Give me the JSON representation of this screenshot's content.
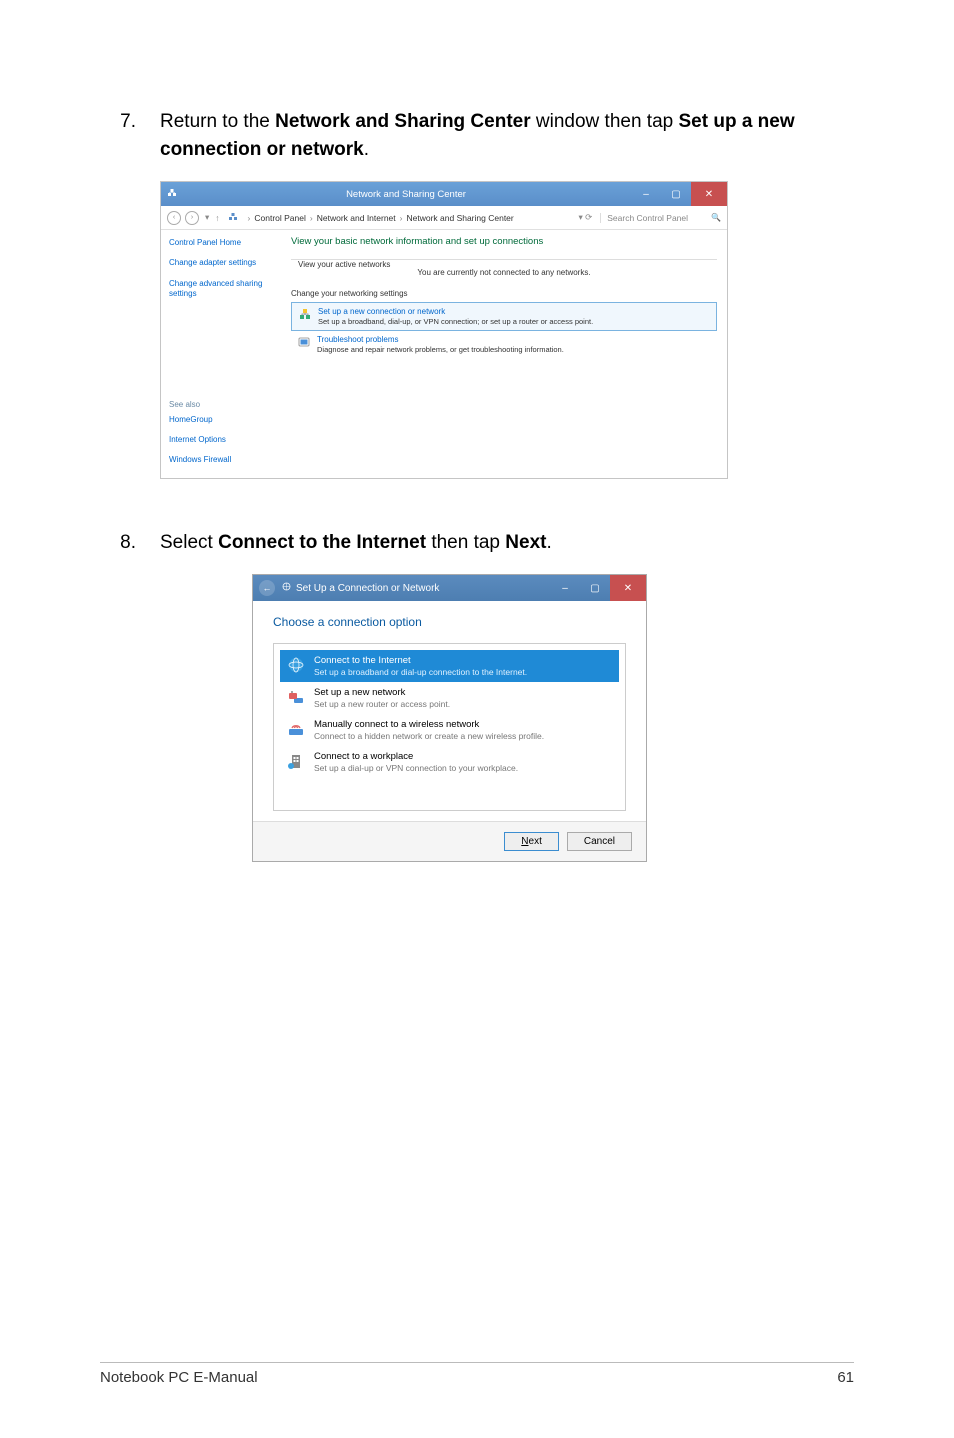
{
  "steps": {
    "s7": {
      "num": "7.",
      "text_before": "Return to the ",
      "bold1": "Network and Sharing Center",
      "text_mid": " window then tap ",
      "bold2": "Set up a new connection or network",
      "text_after": "."
    },
    "s8": {
      "num": "8.",
      "text_before": "Select ",
      "bold1": "Connect to the Internet",
      "text_mid": " then tap ",
      "bold2": "Next",
      "text_after": "."
    }
  },
  "scr1": {
    "title": "Network and Sharing Center",
    "breadcrumb": {
      "root": "Control Panel",
      "mid": "Network and Internet",
      "leaf": "Network and Sharing Center"
    },
    "search_placeholder": "Search Control Panel",
    "sidebar": {
      "home": "Control Panel Home",
      "adapter": "Change adapter settings",
      "advanced": "Change advanced sharing settings",
      "seealso_label": "See also",
      "seealso": {
        "homegroup": "HomeGroup",
        "internet_options": "Internet Options",
        "firewall": "Windows Firewall"
      }
    },
    "main": {
      "header": "View your basic network information and set up connections",
      "active_label": "View your active networks",
      "active_text": "You are currently not connected to any networks.",
      "change_label": "Change your networking settings",
      "setup": {
        "title": "Set up a new connection or network",
        "desc": "Set up a broadband, dial-up, or VPN connection; or set up a router or access point."
      },
      "trouble": {
        "title": "Troubleshoot problems",
        "desc": "Diagnose and repair network problems, or get troubleshooting information."
      }
    }
  },
  "scr2": {
    "title": "Set Up a Connection or Network",
    "heading": "Choose a connection option",
    "options": {
      "o1": {
        "title": "Connect to the Internet",
        "desc": "Set up a broadband or dial-up connection to the Internet."
      },
      "o2": {
        "title": "Set up a new network",
        "desc": "Set up a new router or access point."
      },
      "o3": {
        "title": "Manually connect to a wireless network",
        "desc": "Connect to a hidden network or create a new wireless profile."
      },
      "o4": {
        "title": "Connect to a workplace",
        "desc": "Set up a dial-up or VPN connection to your workplace."
      }
    },
    "buttons": {
      "next": "Next",
      "cancel": "Cancel"
    }
  },
  "footer": {
    "left": "Notebook PC E-Manual",
    "right": "61"
  }
}
